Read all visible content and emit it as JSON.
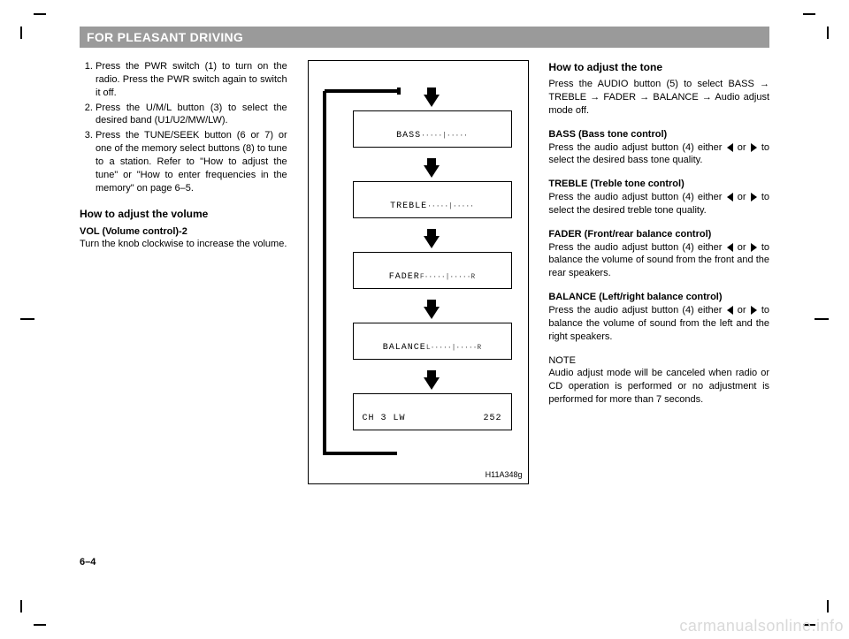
{
  "header": "FOR PLEASANT DRIVING",
  "page_num": "6–4",
  "watermark": "carmanualsonline.info",
  "left": {
    "steps": [
      "Press the PWR switch (1) to turn on the radio.\nPress the PWR switch again to switch it off.",
      "Press the U/M/L button (3) to select the desired band (U1/U2/MW/LW).",
      "Press the TUNE/SEEK button (6 or 7) or one of the memory select buttons (8) to tune to a station.\nRefer to \"How to adjust the tune\" or \"How to enter frequencies in the memory\" on page 6–5."
    ],
    "h_volume": "How to adjust the volume",
    "vol_label": "VOL (Volume control)-2",
    "vol_body": "Turn the knob clockwise to increase the volume."
  },
  "diagram": {
    "screens": [
      "BASS",
      "TREBLE",
      "FADER",
      "BALANCE"
    ],
    "last_screen_left": "CH 3   LW",
    "last_screen_right": "252",
    "fig_label": "H11A348g"
  },
  "right": {
    "h_tone": "How to adjust the tone",
    "tone_body": "Press the AUDIO button (5) to select BASS → TREBLE → FADER → BALANCE → Audio adjust mode off.",
    "bass_h": "BASS (Bass tone control)",
    "bass_b": "Press the audio adjust button (4) either ◀ or ▶ to select the desired bass tone quality.",
    "treble_h": "TREBLE (Treble tone control)",
    "treble_b": "Press the audio adjust button (4) either ◀ or ▶ to select the desired treble tone quality.",
    "fader_h": "FADER (Front/rear balance control)",
    "fader_b": "Press the audio adjust button (4) either ◀ or ▶ to balance the volume of sound from the front and the rear speakers.",
    "balance_h": "BALANCE (Left/right balance control)",
    "balance_b": "Press the audio adjust button (4) either ◀ or ▶ to balance the volume of sound from the left and the right speakers.",
    "note_h": "NOTE",
    "note_b": "Audio adjust mode will be canceled when radio or CD operation is performed or no adjustment is performed for more than 7 seconds."
  }
}
